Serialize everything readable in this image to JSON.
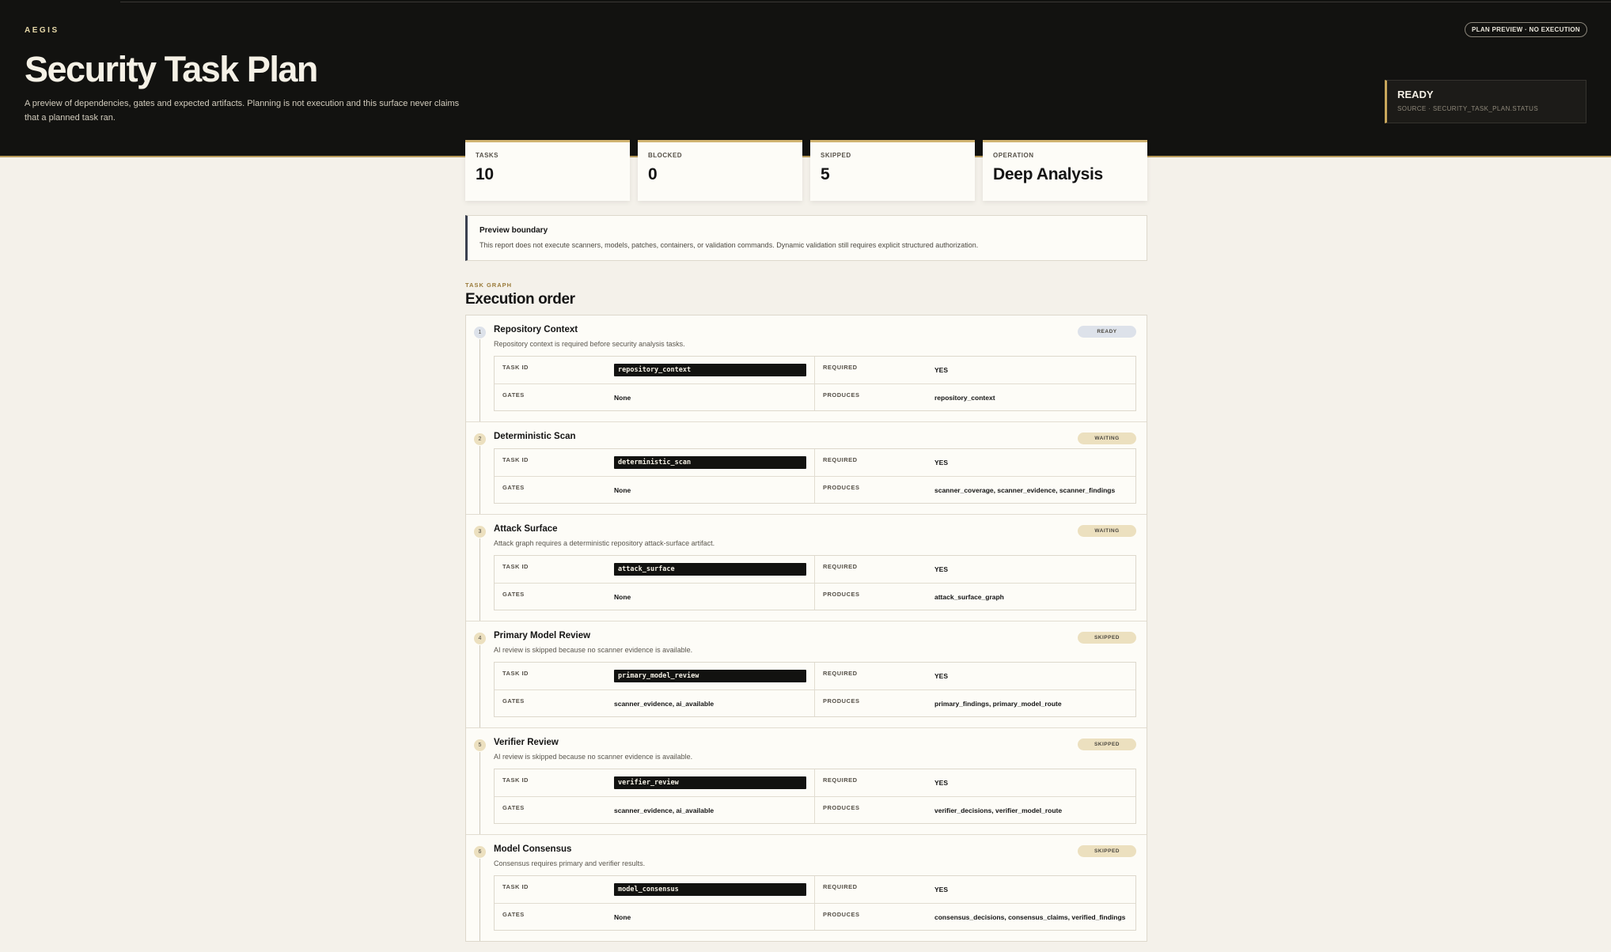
{
  "header": {
    "brand": "AEGIS",
    "title": "Security Task Plan",
    "description": "A preview of dependencies, gates and expected artifacts. Planning is not execution and this surface never claims that a planned task ran.",
    "mode_pill": "PLAN PREVIEW · NO EXECUTION",
    "status": "READY",
    "status_source": "SOURCE · SECURITY_TASK_PLAN.STATUS"
  },
  "stats": [
    {
      "label": "TASKS",
      "value": "10"
    },
    {
      "label": "BLOCKED",
      "value": "0"
    },
    {
      "label": "SKIPPED",
      "value": "5"
    },
    {
      "label": "OPERATION",
      "value": "Deep Analysis"
    }
  ],
  "boundary": {
    "title": "Preview boundary",
    "text": "This report does not execute scanners, models, patches, containers, or validation commands. Dynamic validation still requires explicit structured authorization."
  },
  "graph": {
    "eyebrow": "TASK GRAPH",
    "title": "Execution order"
  },
  "field_labels": {
    "task_id": "TASK ID",
    "required": "REQUIRED",
    "gates": "GATES",
    "produces": "PRODUCES"
  },
  "tasks": [
    {
      "num": "1",
      "name": "Repository Context",
      "status": "READY",
      "desc": "Repository context is required before security analysis tasks.",
      "task_id": "repository_context",
      "required": "YES",
      "gates": "None",
      "produces": "repository_context"
    },
    {
      "num": "2",
      "name": "Deterministic Scan",
      "status": "WAITING",
      "desc": "",
      "task_id": "deterministic_scan",
      "required": "YES",
      "gates": "None",
      "produces": "scanner_coverage, scanner_evidence, scanner_findings"
    },
    {
      "num": "3",
      "name": "Attack Surface",
      "status": "WAITING",
      "desc": "Attack graph requires a deterministic repository attack-surface artifact.",
      "task_id": "attack_surface",
      "required": "YES",
      "gates": "None",
      "produces": "attack_surface_graph"
    },
    {
      "num": "4",
      "name": "Primary Model Review",
      "status": "SKIPPED",
      "desc": "AI review is skipped because no scanner evidence is available.",
      "task_id": "primary_model_review",
      "required": "YES",
      "gates": "scanner_evidence, ai_available",
      "produces": "primary_findings, primary_model_route"
    },
    {
      "num": "5",
      "name": "Verifier Review",
      "status": "SKIPPED",
      "desc": "AI review is skipped because no scanner evidence is available.",
      "task_id": "verifier_review",
      "required": "YES",
      "gates": "scanner_evidence, ai_available",
      "produces": "verifier_decisions, verifier_model_route"
    },
    {
      "num": "6",
      "name": "Model Consensus",
      "status": "SKIPPED",
      "desc": "Consensus requires primary and verifier results.",
      "task_id": "model_consensus",
      "required": "YES",
      "gates": "None",
      "produces": "consensus_decisions, consensus_claims, verified_findings"
    }
  ]
}
